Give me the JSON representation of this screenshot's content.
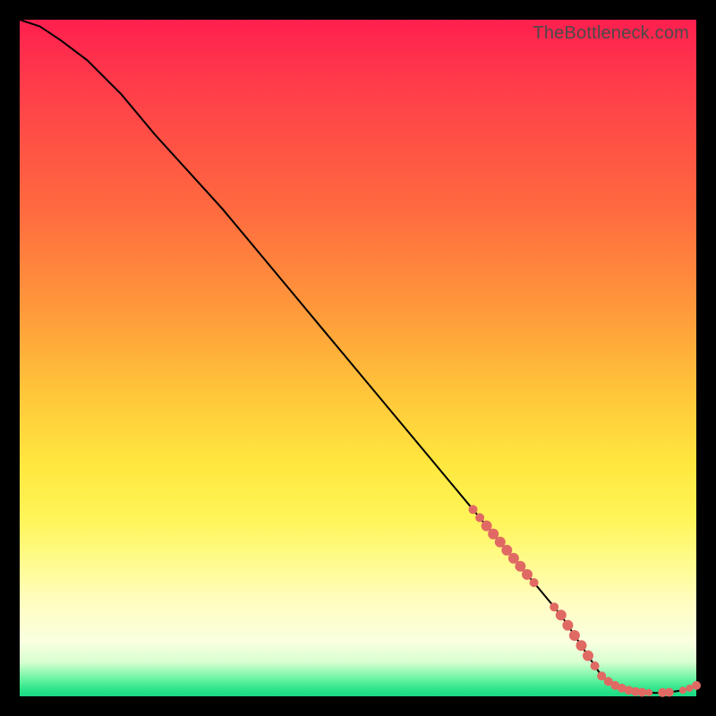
{
  "watermark": "TheBottleneck.com",
  "colors": {
    "curve": "#000000",
    "marker": "#e06a63"
  },
  "chart_data": {
    "type": "line",
    "title": "",
    "xlabel": "",
    "ylabel": "",
    "xlim": [
      0,
      100
    ],
    "ylim": [
      0,
      100
    ],
    "series": [
      {
        "name": "curve",
        "x": [
          0,
          3,
          6,
          10,
          15,
          20,
          25,
          30,
          35,
          40,
          45,
          50,
          55,
          60,
          65,
          70,
          75,
          80,
          84,
          86,
          88,
          90,
          92,
          94,
          96,
          98,
          100
        ],
        "y": [
          100,
          99,
          97,
          94,
          89,
          83,
          77.5,
          72,
          66,
          60,
          54,
          48,
          42,
          36,
          30,
          24,
          18,
          12,
          6,
          3,
          1.6,
          0.9,
          0.6,
          0.5,
          0.6,
          0.9,
          1.6
        ]
      }
    ],
    "markers": {
      "name": "highlighted-points",
      "x": [
        67,
        68,
        69,
        70,
        71,
        72,
        73,
        74,
        75,
        76,
        79,
        80,
        81,
        82,
        83,
        84,
        85,
        86,
        87,
        88,
        89,
        90,
        91,
        92,
        93,
        95,
        96,
        98,
        99,
        100
      ],
      "y": [
        27.6,
        26.4,
        25.2,
        24,
        22.8,
        21.6,
        20.4,
        19.2,
        18,
        16.8,
        13.2,
        12,
        10.5,
        9,
        7.5,
        6,
        4.5,
        3,
        2.2,
        1.6,
        1.2,
        0.9,
        0.7,
        0.6,
        0.55,
        0.55,
        0.6,
        0.9,
        1.2,
        1.6
      ],
      "r": [
        5,
        5,
        6,
        6,
        6,
        6,
        6,
        6,
        6,
        5,
        5,
        6,
        6,
        6,
        6,
        6,
        5,
        5,
        5,
        5,
        5,
        5,
        5,
        5,
        4,
        5,
        5,
        4,
        4,
        5
      ]
    }
  }
}
